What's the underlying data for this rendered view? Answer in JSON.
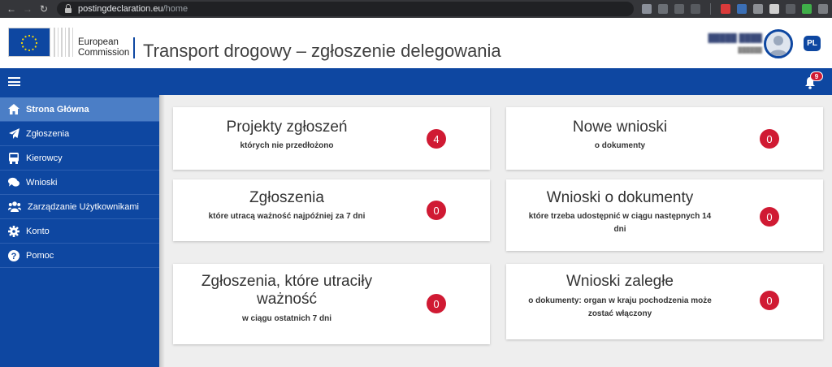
{
  "browser": {
    "url_host": "postingdeclaration.eu",
    "url_path": "/home"
  },
  "header": {
    "org_line1": "European",
    "org_line2": "Commission",
    "app_title": "Transport drogowy – zgłoszenie delegowania",
    "language": "PL",
    "user_name_redacted": true
  },
  "toolbar": {
    "notification_count": "9"
  },
  "sidebar": {
    "items": [
      {
        "label": "Strona Główna",
        "icon": "home-icon",
        "active": true
      },
      {
        "label": "Zgłoszenia",
        "icon": "paper-plane-icon",
        "active": false
      },
      {
        "label": "Kierowcy",
        "icon": "bus-icon",
        "active": false
      },
      {
        "label": "Wnioski",
        "icon": "chat-icon",
        "active": false
      },
      {
        "label": "Zarządzanie Użytkownikami",
        "icon": "users-icon",
        "active": false
      },
      {
        "label": "Konto",
        "icon": "gear-icon",
        "active": false
      },
      {
        "label": "Pomoc",
        "icon": "question-icon",
        "active": false
      }
    ]
  },
  "cards": [
    {
      "title": "Projekty zgłoszeń",
      "subtitle": "których nie przedłożono",
      "count": "4"
    },
    {
      "title": "Nowe wnioski",
      "subtitle": "o dokumenty",
      "count": "0"
    },
    {
      "title": "Zgłoszenia",
      "subtitle": "które utracą ważność najpóźniej za 7 dni",
      "count": "0"
    },
    {
      "title": "Wnioski o dokumenty",
      "subtitle_line1": "które trzeba udostępnić w ciągu następnych 14",
      "subtitle_line2": "dni",
      "count": "0"
    },
    {
      "title_line1": "Zgłoszenia, które utraciły",
      "title_line2": "ważność",
      "subtitle": "w ciągu ostatnich 7 dni",
      "count": "0"
    },
    {
      "title": "Wnioski zaległe",
      "subtitle_line1": "o dokumenty: organ w kraju pochodzenia może",
      "subtitle_line2": "zostać włączony",
      "count": "0"
    }
  ],
  "colors": {
    "brand_blue": "#0e47a1",
    "active_item": "#4b7ec6",
    "badge_red": "#d01a33"
  }
}
